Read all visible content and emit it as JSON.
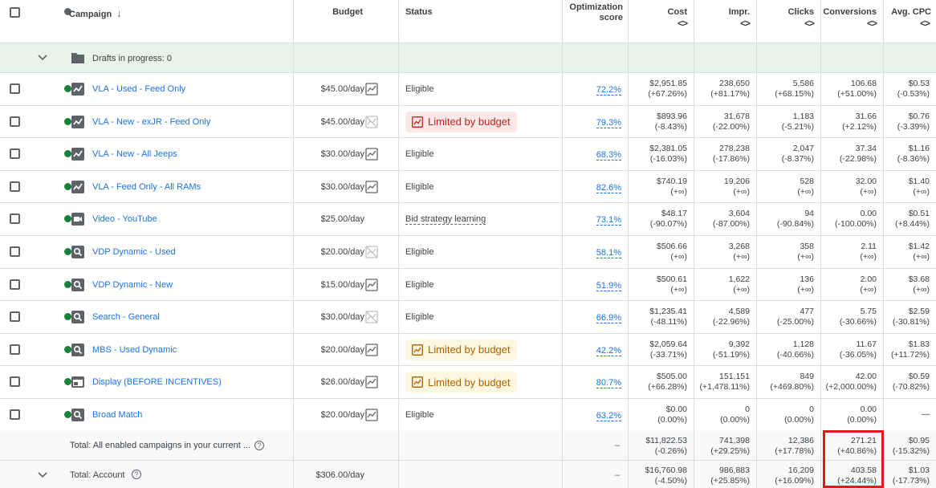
{
  "header": {
    "campaign": "Campaign",
    "budget": "Budget",
    "status": "Status",
    "optimization": "Optimization score",
    "cost": "Cost",
    "impr": "Impr.",
    "clicks": "Clicks",
    "conversions": "Conversions",
    "avg_cpc": "Avg. CPC",
    "sort_icon": "arrow-down-icon",
    "col_icon": "<>"
  },
  "drafts": {
    "label": "Drafts in progress: 0"
  },
  "campaigns": [
    {
      "name": "VLA - Used - Feed Only",
      "type": "shopping-icon",
      "budget": "$45.00/day",
      "budget_icon": "chart",
      "status": "Eligible",
      "status_kind": "plain",
      "opt": "72.2%",
      "cost": "$2,951.85",
      "cost_d": "(+67.26%)",
      "impr": "238,650",
      "impr_d": "(+81.17%)",
      "clicks": "5,586",
      "clicks_d": "(+68.15%)",
      "conv": "106.68",
      "conv_d": "(+51.00%)",
      "cpc": "$0.53",
      "cpc_d": "(-0.53%)"
    },
    {
      "name": "VLA - New - exJR - Feed Only",
      "type": "shopping-icon",
      "budget": "$45.00/day",
      "budget_icon": "disabled",
      "status": "Limited by budget",
      "status_kind": "red",
      "opt": "79.3%",
      "cost": "$893.96",
      "cost_d": "(-8.43%)",
      "impr": "31,678",
      "impr_d": "(-22.00%)",
      "clicks": "1,183",
      "clicks_d": "(-5.21%)",
      "conv": "31.66",
      "conv_d": "(+2.12%)",
      "cpc": "$0.76",
      "cpc_d": "(-3.39%)"
    },
    {
      "name": "VLA - New - All Jeeps",
      "type": "shopping-icon",
      "budget": "$30.00/day",
      "budget_icon": "chart",
      "status": "Eligible",
      "status_kind": "plain",
      "opt": "68.3%",
      "cost": "$2,381.05",
      "cost_d": "(-16.03%)",
      "impr": "278,238",
      "impr_d": "(-17.86%)",
      "clicks": "2,047",
      "clicks_d": "(-8.37%)",
      "conv": "37.34",
      "conv_d": "(-22.98%)",
      "cpc": "$1.16",
      "cpc_d": "(-8.36%)"
    },
    {
      "name": "VLA - Feed Only - All RAMs",
      "type": "shopping-icon",
      "budget": "$30.00/day",
      "budget_icon": "chart",
      "status": "Eligible",
      "status_kind": "plain",
      "opt": "82.6%",
      "cost": "$740.19",
      "cost_d": "(+∞)",
      "impr": "19,206",
      "impr_d": "(+∞)",
      "clicks": "528",
      "clicks_d": "(+∞)",
      "conv": "32.00",
      "conv_d": "(+∞)",
      "cpc": "$1.40",
      "cpc_d": "(+∞)"
    },
    {
      "name": "Video - YouTube",
      "type": "video-icon",
      "budget": "$25.00/day",
      "budget_icon": "none",
      "status": "Bid strategy learning",
      "status_kind": "dashed",
      "opt": "73.1%",
      "cost": "$48.17",
      "cost_d": "(-90.07%)",
      "impr": "3,604",
      "impr_d": "(-87.00%)",
      "clicks": "94",
      "clicks_d": "(-90.84%)",
      "conv": "0.00",
      "conv_d": "(-100.00%)",
      "cpc": "$0.51",
      "cpc_d": "(+8.44%)"
    },
    {
      "name": "VDP Dynamic - Used",
      "type": "search-icon",
      "budget": "$20.00/day",
      "budget_icon": "disabled",
      "status": "Eligible",
      "status_kind": "plain",
      "opt": "58.1%",
      "cost": "$506.66",
      "cost_d": "(+∞)",
      "impr": "3,268",
      "impr_d": "(+∞)",
      "clicks": "358",
      "clicks_d": "(+∞)",
      "conv": "2.11",
      "conv_d": "(+∞)",
      "cpc": "$1.42",
      "cpc_d": "(+∞)"
    },
    {
      "name": "VDP Dynamic - New",
      "type": "search-icon",
      "budget": "$15.00/day",
      "budget_icon": "chart",
      "status": "Eligible",
      "status_kind": "plain",
      "opt": "51.9%",
      "cost": "$500.61",
      "cost_d": "(+∞)",
      "impr": "1,622",
      "impr_d": "(+∞)",
      "clicks": "136",
      "clicks_d": "(+∞)",
      "conv": "2.00",
      "conv_d": "(+∞)",
      "cpc": "$3.68",
      "cpc_d": "(+∞)"
    },
    {
      "name": "Search - General",
      "type": "search-icon",
      "budget": "$30.00/day",
      "budget_icon": "disabled",
      "status": "Eligible",
      "status_kind": "plain",
      "opt": "66.9%",
      "cost": "$1,235.41",
      "cost_d": "(-48.11%)",
      "impr": "4,589",
      "impr_d": "(-22.96%)",
      "clicks": "477",
      "clicks_d": "(-25.00%)",
      "conv": "5.75",
      "conv_d": "(-30.66%)",
      "cpc": "$2.59",
      "cpc_d": "(-30.81%)"
    },
    {
      "name": "MBS - Used Dynamic",
      "type": "search-icon",
      "budget": "$20.00/day",
      "budget_icon": "chart",
      "status": "Limited by budget",
      "status_kind": "orange",
      "opt": "42.2%",
      "cost": "$2,059.64",
      "cost_d": "(-33.71%)",
      "impr": "9,392",
      "impr_d": "(-51.19%)",
      "clicks": "1,128",
      "clicks_d": "(-40.66%)",
      "conv": "11.67",
      "conv_d": "(-36.05%)",
      "cpc": "$1.83",
      "cpc_d": "(+11.72%)"
    },
    {
      "name": "Display (BEFORE INCENTIVES)",
      "type": "display-icon",
      "budget": "$26.00/day",
      "budget_icon": "chart",
      "status": "Limited by budget",
      "status_kind": "orange",
      "opt": "80.7%",
      "cost": "$505.00",
      "cost_d": "(+66.28%)",
      "impr": "151,151",
      "impr_d": "(+1,478.11%)",
      "clicks": "849",
      "clicks_d": "(+469.80%)",
      "conv": "42.00",
      "conv_d": "(+2,000.00%)",
      "cpc": "$0.59",
      "cpc_d": "(-70.82%)"
    },
    {
      "name": "Broad Match",
      "type": "search-icon",
      "budget": "$20.00/day",
      "budget_icon": "chart",
      "status": "Eligible",
      "status_kind": "plain",
      "opt": "63.2%",
      "cost": "$0.00",
      "cost_d": "(0.00%)",
      "impr": "0",
      "impr_d": "(0.00%)",
      "clicks": "0",
      "clicks_d": "(0.00%)",
      "conv": "0.00",
      "conv_d": "(0.00%)",
      "cpc": "—",
      "cpc_d": ""
    }
  ],
  "total_enabled": {
    "label": "Total: All enabled campaigns in your current ...",
    "opt": "–",
    "cost": "$11,822.53",
    "cost_d": "(-0.26%)",
    "impr": "741,398",
    "impr_d": "(+29.25%)",
    "clicks": "12,386",
    "clicks_d": "(+17.78%)",
    "conv": "271.21",
    "conv_d": "(+40.86%)",
    "cpc": "$0.95",
    "cpc_d": "(-15.32%)"
  },
  "total_account": {
    "label": "Total: Account",
    "budget": "$306.00/day",
    "opt": "–",
    "cost": "$16,760.98",
    "cost_d": "(-4.50%)",
    "impr": "986,883",
    "impr_d": "(+25.85%)",
    "clicks": "16,209",
    "clicks_d": "(+16.09%)",
    "conv": "403.58",
    "conv_d": "(+24.44%)",
    "cpc": "$1.03",
    "cpc_d": "(-17.73%)"
  },
  "colors": {
    "link": "#1a73e8",
    "eligible_dot": "#188038",
    "drafts_bg": "#e6f4ea",
    "highlight": "#e01b1b"
  }
}
